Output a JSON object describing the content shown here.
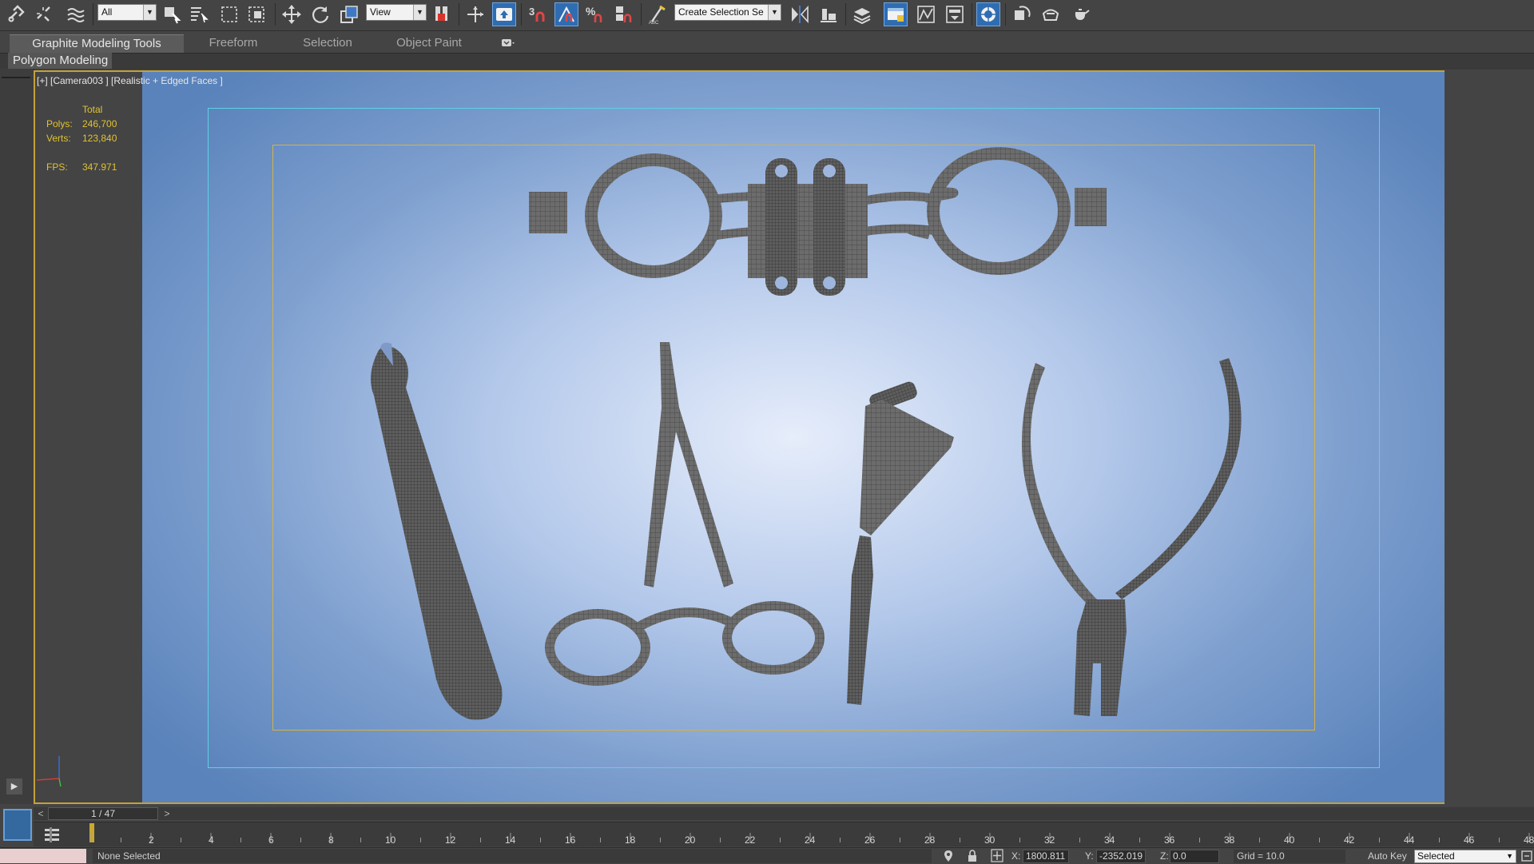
{
  "toolbar": {
    "selection_filter": "All",
    "ref_coord_system": "View",
    "selection_set_placeholder": "Create Selection Se",
    "snap_3d_label": "3",
    "percent_snap_label": "%"
  },
  "ribbon": {
    "tabs": [
      {
        "label": "Graphite Modeling Tools",
        "active": true
      },
      {
        "label": "Freeform",
        "active": false
      },
      {
        "label": "Selection",
        "active": false
      },
      {
        "label": "Object Paint",
        "active": false
      }
    ],
    "panel_label": "Polygon Modeling"
  },
  "viewport": {
    "label": "[+] [Camera003 ] [Realistic + Edged Faces ]",
    "stats": {
      "total_header": "Total",
      "polys_label": "Polys:",
      "polys_value": "246,700",
      "verts_label": "Verts:",
      "verts_value": "123,840",
      "fps_label": "FPS:",
      "fps_value": "347.971"
    },
    "background_colors": {
      "center": "#e6edfb",
      "edge": "#5a83bb"
    },
    "safe_frame_color": "#5cd1e6",
    "render_frame_color": "#d4b24a",
    "model_color": "#666666"
  },
  "timeline": {
    "frame_display": "1 / 47",
    "prev_arrow": "<",
    "next_arrow": ">",
    "ruler_labels": [
      "2",
      "4",
      "6",
      "8",
      "10",
      "12",
      "14",
      "16",
      "18",
      "20",
      "22",
      "24",
      "26",
      "28",
      "30",
      "32",
      "34",
      "36",
      "38",
      "40",
      "42",
      "44",
      "46",
      "48"
    ]
  },
  "status": {
    "selection_text": "None Selected",
    "x_label": "X:",
    "x_value": "1800.811",
    "y_label": "Y:",
    "y_value": "-2352.019",
    "z_label": "Z:",
    "z_value": "0.0",
    "grid_text": "Grid = 10.0",
    "autokey_label": "Auto Key",
    "key_filter": "Selected"
  }
}
